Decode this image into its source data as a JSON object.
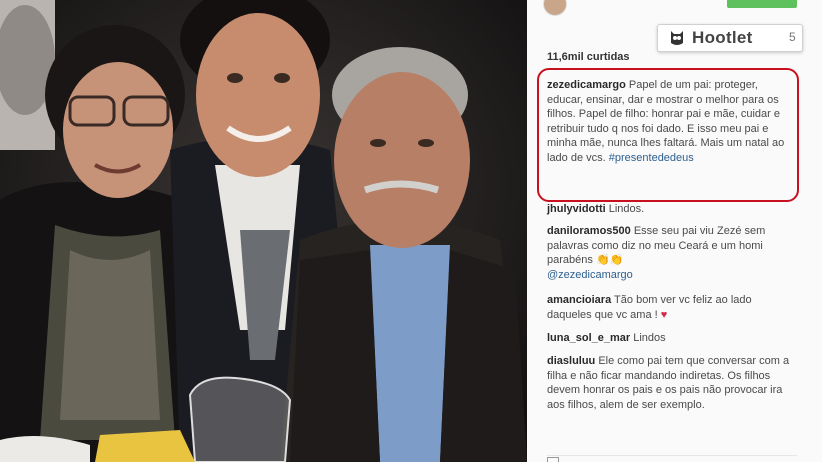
{
  "photo": {
    "alt": "Três pessoas posando para foto"
  },
  "panel": {
    "likes": "11,6mil curtidas",
    "hootlet_label": "Hootlet",
    "hootlet_extra": "5",
    "caption": {
      "username": "zezedicamargo",
      "text": " Papel de um pai: proteger, educar, ensinar, dar e mostrar o melhor para os filhos. Papel de filho: honrar pai e mãe, cuidar e retribuir tudo q nos foi dado. E isso meu pai e minha mãe, nunca lhes faltará. Mais um natal ao lado de vcs. ",
      "hashtag": "#presentededeus"
    },
    "comments": [
      {
        "username": "jhulyvidotti",
        "text": " Lindos."
      },
      {
        "username": "daniloramos500",
        "text": " Esse seu pai viu Zezé sem palavras como diz no meu Ceará e um homi parabéns ",
        "emoji": "👏👏",
        "mention": "@zezedicamargo"
      },
      {
        "username": "amancioiara",
        "text": " Tão bom ver vc feliz ao lado daqueles que vc ama ! ",
        "emoji": "♥"
      },
      {
        "username": "luna_sol_e_mar",
        "text": " Lindos"
      },
      {
        "username": "diasluluu",
        "text": " Ele como pai tem que conversar com a filha e não ficar mandando indiretas. Os filhos devem honrar os pais e os pais não provocar ira aos filhos, alem de ser exemplo."
      }
    ]
  },
  "colors": {
    "highlight": "#c8101e",
    "hashtag": "#2d5f8f",
    "follow": "#5ec15e"
  }
}
